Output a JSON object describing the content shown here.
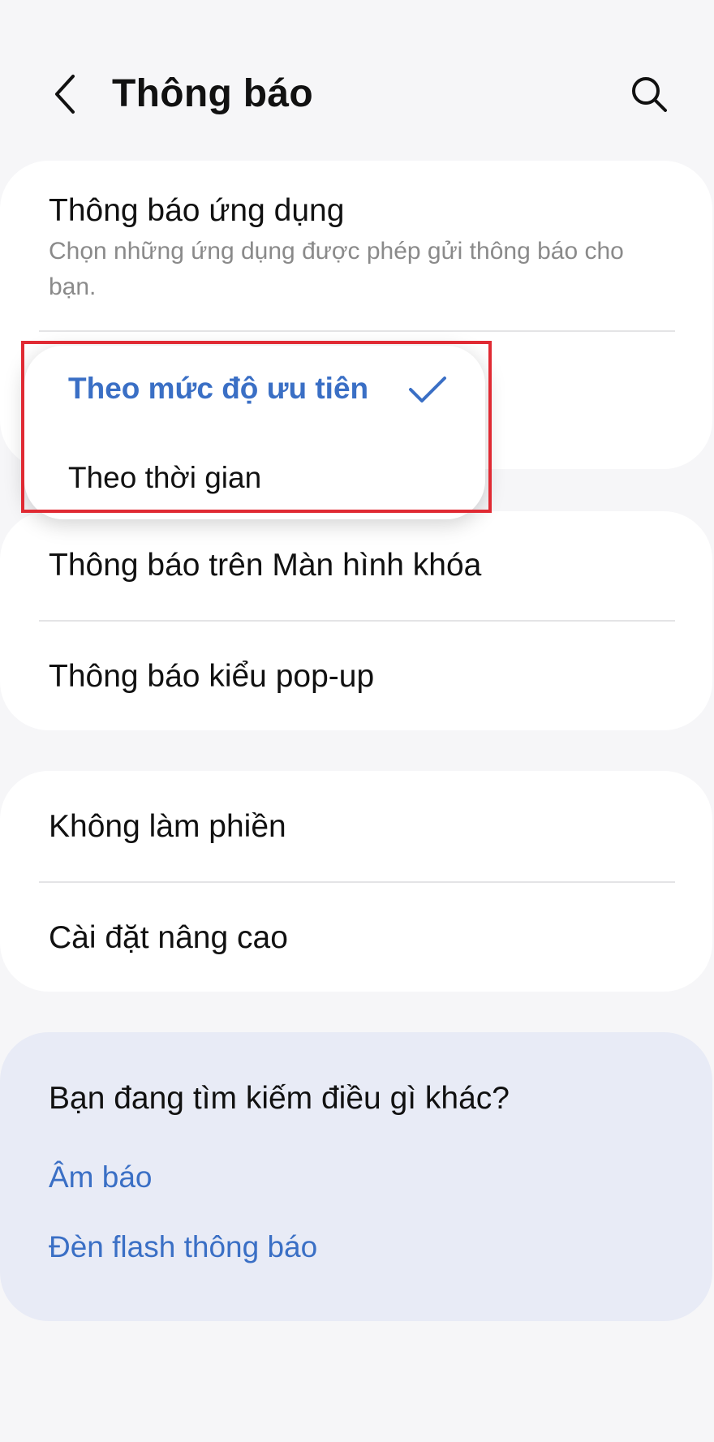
{
  "header": {
    "title": "Thông báo",
    "back_icon": "chevron-left-icon",
    "search_icon": "search-icon"
  },
  "card1": {
    "app_notifications": {
      "title": "Thông báo ứng dụng",
      "subtitle": "Chọn những ứng dụng được phép gửi thông báo cho bạn."
    }
  },
  "dropdown": {
    "options": [
      {
        "label": "Theo mức độ ưu tiên",
        "selected": true
      },
      {
        "label": "Theo thời gian",
        "selected": false
      }
    ],
    "check_icon": "check-icon"
  },
  "card2": {
    "items": [
      "Thông báo trên Màn hình khóa",
      "Thông báo kiểu pop-up"
    ]
  },
  "card3": {
    "items": [
      "Không làm phiền",
      "Cài đặt nâng cao"
    ]
  },
  "suggestions": {
    "heading": "Bạn đang tìm kiếm điều gì khác?",
    "links": [
      "Âm báo",
      "Đèn flash thông báo"
    ]
  },
  "colors": {
    "background": "#f6f6f8",
    "card": "#ffffff",
    "suggestion_card": "#e8ebf6",
    "accent": "#3a6fc5",
    "highlight": "#e02a33"
  }
}
